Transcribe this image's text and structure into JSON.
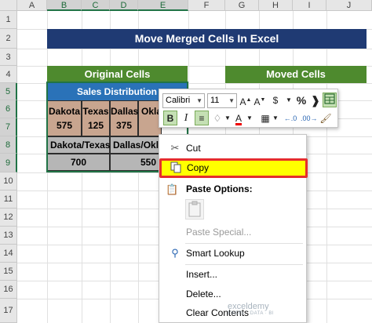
{
  "grid": {
    "columns": [
      "A",
      "B",
      "C",
      "D",
      "E",
      "F",
      "G",
      "H",
      "I",
      "J"
    ],
    "rows": [
      "1",
      "2",
      "3",
      "4",
      "5",
      "6",
      "7",
      "8",
      "9",
      "10",
      "11",
      "12",
      "13",
      "14",
      "15",
      "16",
      "17"
    ]
  },
  "sheet": {
    "title": "Move Merged Cells In Excel",
    "original_header": "Original Cells",
    "moved_header": "Moved Cells",
    "table_header": "Sales Distribution",
    "cities": [
      "Dakota",
      "Texas",
      "Dallas",
      "Okla"
    ],
    "values": [
      "575",
      "125",
      "375",
      ""
    ],
    "group_labels": [
      "Dakota/Texas",
      "Dallas/Okla"
    ],
    "group_values": [
      "700",
      "550"
    ]
  },
  "mini_toolbar": {
    "font_name": "Calibri",
    "font_size": "11",
    "buttons_row1": [
      "A^",
      "A˅",
      "$",
      "%",
      ")",
      "»"
    ],
    "bold_label": "B",
    "italic_label": "I"
  },
  "context_menu": {
    "items": [
      {
        "label": "Cut",
        "icon": "scissors-icon"
      },
      {
        "label": "Copy",
        "icon": "copy-icon"
      },
      {
        "label": "Paste Special...",
        "icon": ""
      },
      {
        "label": "Smart Lookup",
        "icon": "search-icon"
      },
      {
        "label": "Insert...",
        "icon": ""
      },
      {
        "label": "Delete...",
        "icon": ""
      },
      {
        "label": "Clear Contents",
        "icon": ""
      }
    ],
    "paste_options_label": "Paste Options:"
  },
  "watermark": {
    "brand": "exceldemy",
    "tagline": "EXCEL · DATA · BI"
  },
  "colors": {
    "title_bg": "#1f3a73",
    "green_header": "#4e8a2e",
    "blue_header": "#2a72b8",
    "tan_cell": "#c8a58f",
    "gray_cell": "#b6b6b6",
    "highlight": "#ffff00",
    "highlight_border": "#e52d2d"
  }
}
